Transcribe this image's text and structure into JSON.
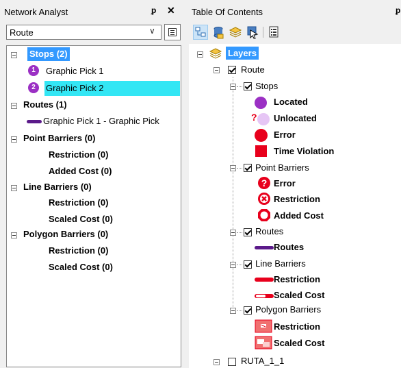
{
  "network_analyst": {
    "title": "Network Analyst",
    "pin_glyph": "\u0004",
    "close_glyph": "✕",
    "layer_select": {
      "value": "Route"
    },
    "tree": {
      "stops_label": "Stops (2)",
      "stops_items": [
        {
          "number": "1",
          "label": "Graphic Pick 1"
        },
        {
          "number": "2",
          "label": "Graphic Pick 2"
        }
      ],
      "routes_label": "Routes (1)",
      "routes_items": [
        {
          "label": "Graphic Pick 1 - Graphic Pick"
        }
      ],
      "point_barriers_label": "Point Barriers (0)",
      "point_barriers_items": [
        "Restriction (0)",
        "Added Cost (0)"
      ],
      "line_barriers_label": "Line Barriers (0)",
      "line_barriers_items": [
        "Restriction (0)",
        "Scaled Cost (0)"
      ],
      "polygon_barriers_label": "Polygon Barriers (0)",
      "polygon_barriers_items": [
        "Restriction (0)",
        "Scaled Cost (0)"
      ]
    }
  },
  "toc": {
    "title": "Table Of Contents",
    "pin_glyph": "\u0004",
    "toolbar": [
      "list-by-drawing-order-icon",
      "list-by-source-icon",
      "list-by-visibility-icon",
      "list-by-selection-icon",
      "options-icon"
    ],
    "root_label": "Layers",
    "route_layer": {
      "label": "Route",
      "checked": true
    },
    "stops": {
      "label": "Stops",
      "checked": true,
      "legend": [
        "Located",
        "Unlocated",
        "Error",
        "Time Violation"
      ]
    },
    "point_barriers": {
      "label": "Point Barriers",
      "checked": true,
      "legend": [
        "Error",
        "Restriction",
        "Added Cost"
      ]
    },
    "routes": {
      "label": "Routes",
      "checked": true,
      "legend": [
        "Routes"
      ]
    },
    "line_barriers": {
      "label": "Line Barriers",
      "checked": true,
      "legend": [
        "Restriction",
        "Scaled Cost"
      ]
    },
    "polygon_barriers": {
      "label": "Polygon Barriers",
      "checked": true,
      "legend": [
        "Restriction",
        "Scaled Cost"
      ]
    },
    "ruta_layer": {
      "label": "RUTA_1_1",
      "checked": false
    }
  },
  "colors": {
    "selection_blue": "#3399ff",
    "selection_cyan": "#33e6f4",
    "stop_purple": "#9b30c4",
    "route_purple": "#5b1a8a",
    "error_red": "#e8001c",
    "unlocated_lilac": "#e6c6f5"
  }
}
